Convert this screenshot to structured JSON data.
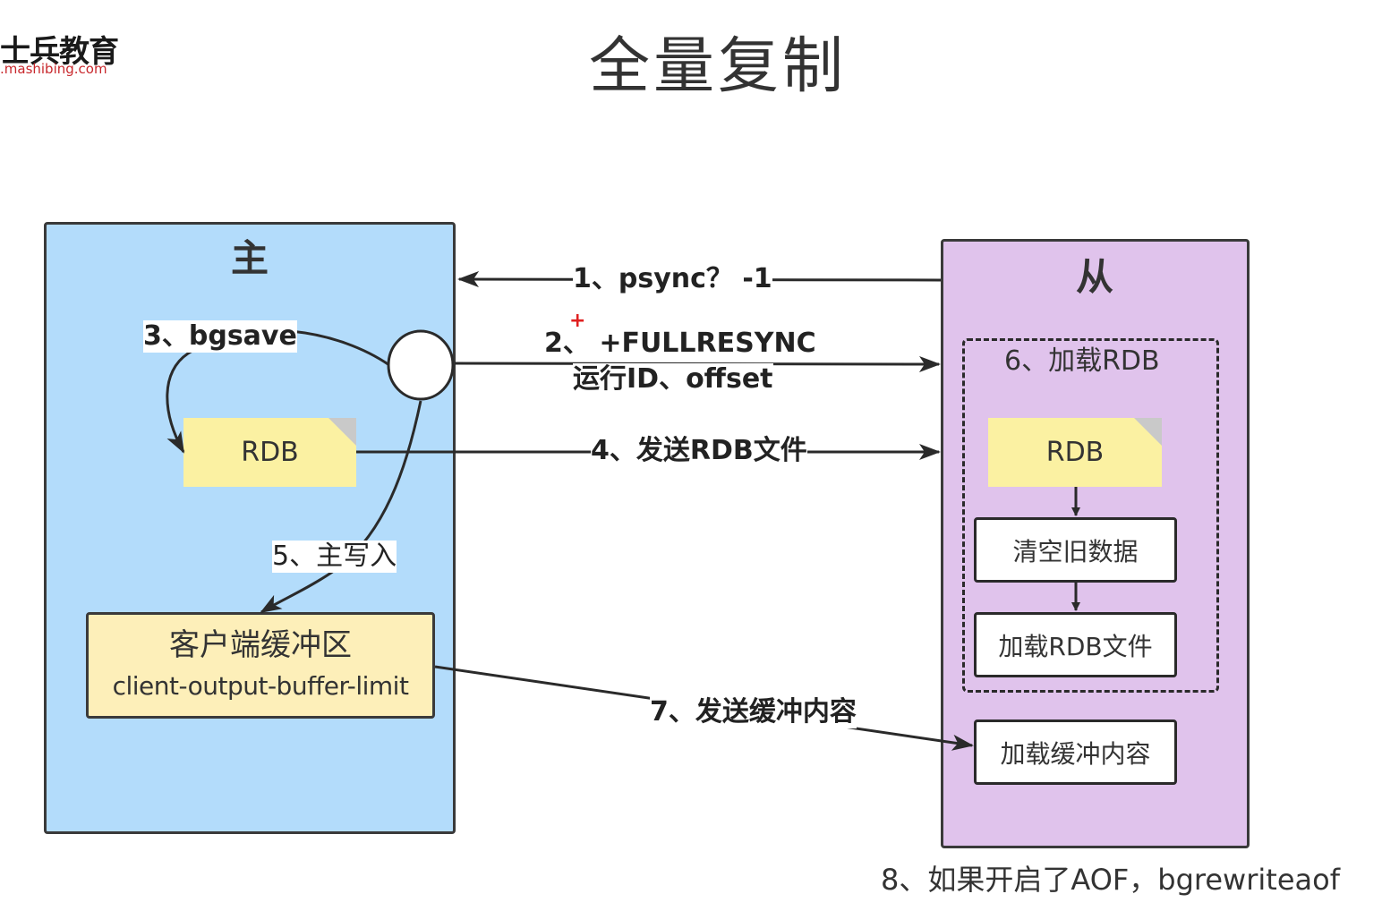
{
  "logo": {
    "name": "士兵教育",
    "url": ".mashibing.com"
  },
  "title": "全量复制",
  "master": {
    "title": "主",
    "rdb": "RDB",
    "buffer_line1": "客户端缓冲区",
    "buffer_line2": "client-output-buffer-limit"
  },
  "slave": {
    "title": "从",
    "rdb": "RDB",
    "clear": "清空旧数据",
    "load_file": "加载RDB文件",
    "load_buffer": "加载缓冲内容"
  },
  "steps": {
    "s1": "1、psync？ -1",
    "s2_line1": "2、 +FULLRESYNC",
    "s2_line2": "运行ID、offset",
    "s3": "3、bgsave",
    "s4": "4、发送RDB文件",
    "s5": "5、主写入",
    "s6": "6、加载RDB",
    "s7": "7、发送缓冲内容",
    "s8": "8、如果开启了AOF，bgrewriteaof"
  },
  "marker": "+",
  "colors": {
    "master_bg": "#b3dcfb",
    "slave_bg": "#e0c3ec",
    "note_bg": "#fbf1a2",
    "buffer_bg": "#fdefb9"
  }
}
